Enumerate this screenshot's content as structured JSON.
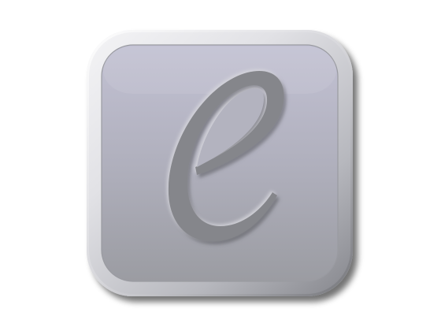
{
  "app_icon": {
    "glyph": "e",
    "name": "app-icon",
    "colors": {
      "background": "#ffffff",
      "bezel_light": "#f4f4f6",
      "bezel_mid": "#cfd0d6",
      "bezel_dark": "#8d8e94",
      "face_top": "#c2c1d3",
      "face_bottom": "#9b9ca2",
      "glyph_fill": "#85868b",
      "glyph_highlight": "#b4b5bb",
      "shadow": "#3c3c40"
    }
  }
}
